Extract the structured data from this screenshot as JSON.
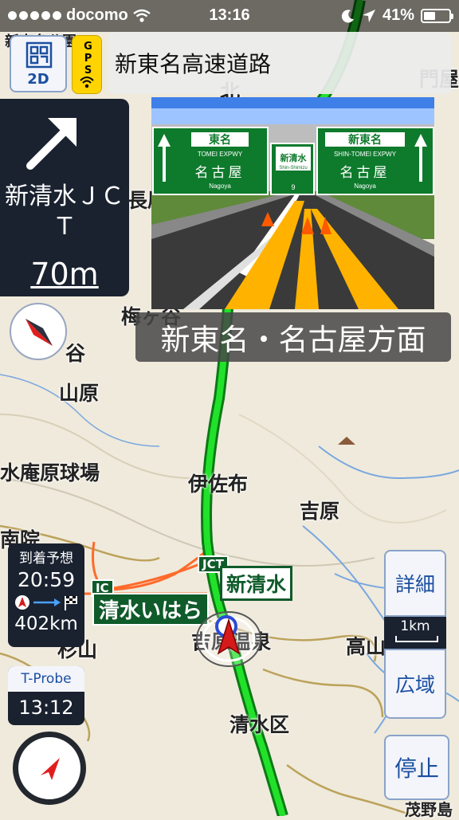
{
  "status_bar": {
    "carrier": "docomo",
    "time": "13:16",
    "battery": "41%"
  },
  "top_controls": {
    "view_mode_label": "2D",
    "gps_label": "GPS",
    "road_name": "新東名高速道路"
  },
  "guidance": {
    "junction_name": "新清水ＪＣＴ",
    "distance": "70m",
    "direction_text": "新東名・名古屋方面"
  },
  "junction_signs": {
    "left_sign": {
      "title": "東名",
      "subtitle": "TOMEI EXPWY",
      "city": "名古屋",
      "city_en": "Nagoya"
    },
    "center_sign": {
      "title": "新清水",
      "subtitle": "Shin-Shimizu",
      "number": "9"
    },
    "right_sign": {
      "title": "新東名",
      "subtitle": "SHIN-TOMEI EXPWY",
      "city": "名古屋",
      "city_en": "Nagoya"
    }
  },
  "map_labels": {
    "top_partial": "新東名公園",
    "kita": "北",
    "monya": "門屋",
    "nagahara": "長原",
    "umegaya": "梅ヶ谷",
    "tani": "谷",
    "yamahara": "山原",
    "kyujo": "水庵原球場",
    "isaho": "伊佐布",
    "yoshiwara": "吉原",
    "in": "南院",
    "sugiyama": "杉山",
    "onsen": "吉原温泉",
    "takayama": "高山",
    "shimizu_ku": "清水区",
    "moyama": "茂野島",
    "ic_tag": "IC",
    "jct_tag": "JCT",
    "ic_name": "清水いはら",
    "jct_name": "新清水"
  },
  "eta_panel": {
    "heading": "到着予想",
    "time": "20:59",
    "distance": "402km"
  },
  "tprobe_panel": {
    "heading": "T-Probe",
    "time": "13:12"
  },
  "right_controls": {
    "detail_label": "詳細",
    "scale_label": "1km",
    "wide_label": "広域",
    "stop_label": "停止"
  },
  "colors": {
    "route": "#1fd32a",
    "panel_dark": "#1a2230",
    "button_text": "#1b4fa0",
    "sign_green": "#0e7a2c",
    "expressway_shield": "#0f5b2a"
  }
}
